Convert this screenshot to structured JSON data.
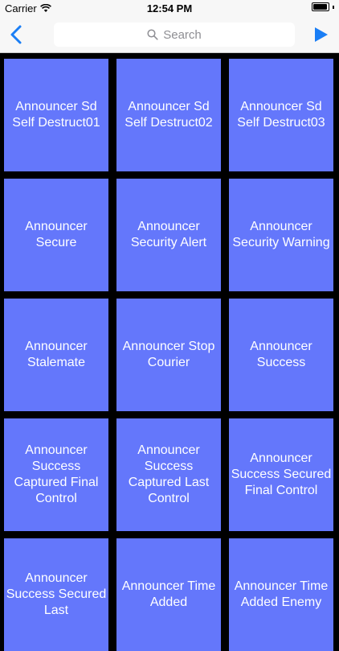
{
  "status_bar": {
    "carrier": "Carrier",
    "time": "12:54 PM"
  },
  "nav": {
    "search_placeholder": "Search"
  },
  "tiles": [
    "Announcer Sd Self Destruct01",
    "Announcer Sd Self Destruct02",
    "Announcer Sd Self Destruct03",
    "Announcer Secure",
    "Announcer Security Alert",
    "Announcer Security Warning",
    "Announcer Stalemate",
    "Announcer Stop Courier",
    "Announcer Success",
    "Announcer Success Captured Final Control",
    "Announcer Success Captured Last Control",
    "Announcer Success Secured Final Control",
    "Announcer Success Secured Last",
    "Announcer Time Added",
    "Announcer Time Added Enemy"
  ],
  "colors": {
    "tile": "#6477fb",
    "accent": "#1a7ef5"
  }
}
